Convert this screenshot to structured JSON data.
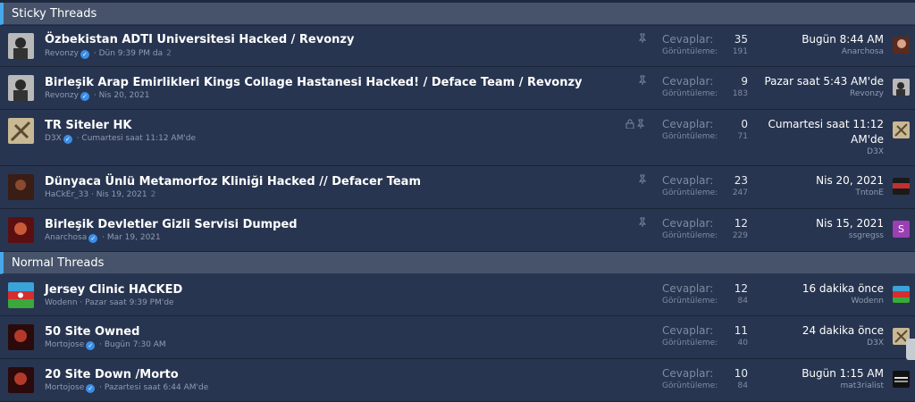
{
  "sections": {
    "sticky": "Sticky Threads",
    "normal": "Normal Threads"
  },
  "labels": {
    "replies": "Cevaplar:",
    "views": "Görüntüleme:"
  },
  "threads": [
    {
      "title": "Özbekistan ADTI Universitesi Hacked / Revonzy",
      "author": "Revonzy",
      "date": "Dün 9:39 PM da",
      "pages": "2",
      "replies": "35",
      "views": "191",
      "last_date": "Bugün 8:44 AM",
      "last_user": "Anarchosa"
    },
    {
      "title": "Birleşik Arap Emirlikleri Kings Collage Hastanesi Hacked! / Deface Team / Revonzy",
      "author": "Revonzy",
      "date": "Nis 20, 2021",
      "pages": "",
      "replies": "9",
      "views": "183",
      "last_date": "Pazar saat 5:43 AM'de",
      "last_user": "Revonzy"
    },
    {
      "title": "TR Siteler HK",
      "author": "D3X",
      "date": "Cumartesi saat 11:12 AM'de",
      "pages": "",
      "replies": "0",
      "views": "71",
      "last_date_1": "Cumartesi saat 11:12",
      "last_date_2": "AM'de",
      "last_user": "D3X"
    },
    {
      "title": "Dünyaca Ünlü Metamorfoz Kliniği Hacked // Defacer Team",
      "author": "HaCkEr_33",
      "date": "Nis 19, 2021",
      "pages": "2",
      "replies": "23",
      "views": "247",
      "last_date": "Nis 20, 2021",
      "last_user": "TntonE"
    },
    {
      "title": "Birleşik Devletler Gizli Servisi Dumped",
      "author": "Anarchosa",
      "date": "Mar 19, 2021",
      "pages": "",
      "replies": "12",
      "views": "229",
      "last_date": "Nis 15, 2021",
      "last_user": "ssgregss",
      "last_avatar_letter": "S"
    },
    {
      "title": "Jersey Clinic HACKED",
      "author": "Wodenn",
      "date": "Pazar saat 9:39 PM'de",
      "pages": "",
      "replies": "12",
      "views": "84",
      "last_date": "16 dakika önce",
      "last_user": "Wodenn"
    },
    {
      "title": "50 Site Owned",
      "author": "Mortojose",
      "date": "Bugün 7:30 AM",
      "pages": "",
      "replies": "11",
      "views": "40",
      "last_date": "24 dakika önce",
      "last_user": "D3X"
    },
    {
      "title": "20 Site Down /Morto",
      "author": "Mortojose",
      "date": "Pazartesi saat 6:44 AM'de",
      "pages": "",
      "replies": "10",
      "views": "84",
      "last_date": "Bugün 1:15 AM",
      "last_user": "mat3rialist"
    }
  ],
  "icon_names": [
    "pin-icon",
    "lock-icon",
    "verified-badge-icon"
  ]
}
